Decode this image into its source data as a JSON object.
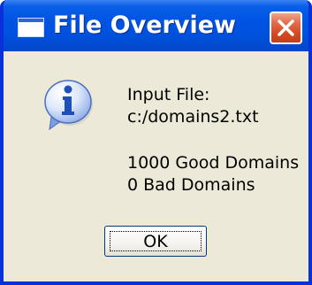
{
  "window": {
    "title": "File Overview"
  },
  "message": {
    "input_file_label": "Input File:",
    "input_file_path": "c:/domains2.txt",
    "good_domains": "1000 Good Domains",
    "bad_domains": "0 Bad Domains"
  },
  "buttons": {
    "ok_label": "OK"
  },
  "icons": {
    "title": "window-app-icon",
    "close": "close-icon",
    "message": "information-icon"
  },
  "colors": {
    "titlebar": "#0054e3",
    "frame": "#0831d9",
    "dialog_background": "#ece9d8",
    "close_button": "#d24a23"
  }
}
